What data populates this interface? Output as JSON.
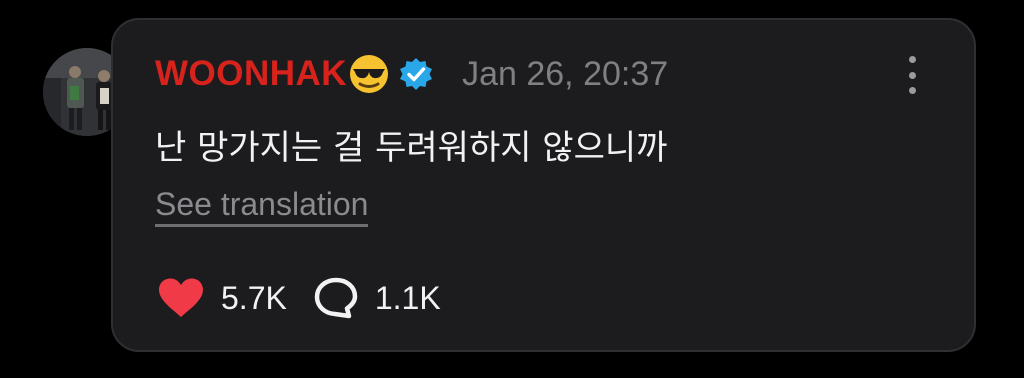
{
  "post": {
    "username": "WOONHAK",
    "username_color": "#d8231d",
    "username_emoji": "smiling-face-with-sunglasses",
    "verified_badge": "verified-icon",
    "timestamp": "Jan 26, 20:37",
    "message": "난 망가지는 걸 두려워하지 않으니까",
    "translate_label": "See translation",
    "likes": "5.7K",
    "replies": "1.1K",
    "like_icon": "heart-icon",
    "reply_icon": "comment-bubble-icon",
    "more_icon": "more-vertical-icon"
  },
  "colors": {
    "background": "#000000",
    "card": "#1c1c1e",
    "heart": "#f03a47",
    "verified": "#2aa7e8"
  }
}
